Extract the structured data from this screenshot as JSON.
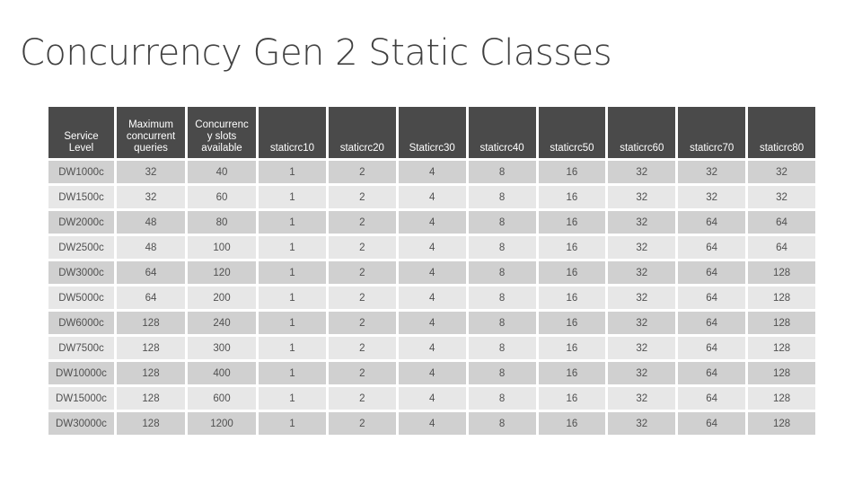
{
  "title": "Concurrency Gen 2 Static Classes",
  "table": {
    "headers": [
      "Service Level",
      "Maximum concurrent queries",
      "Concurrency slots available",
      "staticrc10",
      "staticrc20",
      "Staticrc30",
      "staticrc40",
      "staticrc50",
      "staticrc60",
      "staticrc70",
      "staticrc80"
    ],
    "headers_display": [
      "Service\nLevel",
      "Maximum\nconcurrent\nqueries",
      "Concurrenc\ny slots\navailable",
      "staticrc10",
      "staticrc20",
      "Staticrc30",
      "staticrc40",
      "staticrc50",
      "staticrc60",
      "staticrc70",
      "staticrc80"
    ],
    "rows": [
      [
        "DW1000c",
        "32",
        "40",
        "1",
        "2",
        "4",
        "8",
        "16",
        "32",
        "32",
        "32"
      ],
      [
        "DW1500c",
        "32",
        "60",
        "1",
        "2",
        "4",
        "8",
        "16",
        "32",
        "32",
        "32"
      ],
      [
        "DW2000c",
        "48",
        "80",
        "1",
        "2",
        "4",
        "8",
        "16",
        "32",
        "64",
        "64"
      ],
      [
        "DW2500c",
        "48",
        "100",
        "1",
        "2",
        "4",
        "8",
        "16",
        "32",
        "64",
        "64"
      ],
      [
        "DW3000c",
        "64",
        "120",
        "1",
        "2",
        "4",
        "8",
        "16",
        "32",
        "64",
        "128"
      ],
      [
        "DW5000c",
        "64",
        "200",
        "1",
        "2",
        "4",
        "8",
        "16",
        "32",
        "64",
        "128"
      ],
      [
        "DW6000c",
        "128",
        "240",
        "1",
        "2",
        "4",
        "8",
        "16",
        "32",
        "64",
        "128"
      ],
      [
        "DW7500c",
        "128",
        "300",
        "1",
        "2",
        "4",
        "8",
        "16",
        "32",
        "64",
        "128"
      ],
      [
        "DW10000c",
        "128",
        "400",
        "1",
        "2",
        "4",
        "8",
        "16",
        "32",
        "64",
        "128"
      ],
      [
        "DW15000c",
        "128",
        "600",
        "1",
        "2",
        "4",
        "8",
        "16",
        "32",
        "64",
        "128"
      ],
      [
        "DW30000c",
        "128",
        "1200",
        "1",
        "2",
        "4",
        "8",
        "16",
        "32",
        "64",
        "128"
      ]
    ]
  },
  "colors": {
    "header_bg": "#4a4a4a",
    "header_text": "#ffffff",
    "row_dark": "#d0d0d0",
    "row_light": "#e7e7e7",
    "title_text": "#404040"
  }
}
